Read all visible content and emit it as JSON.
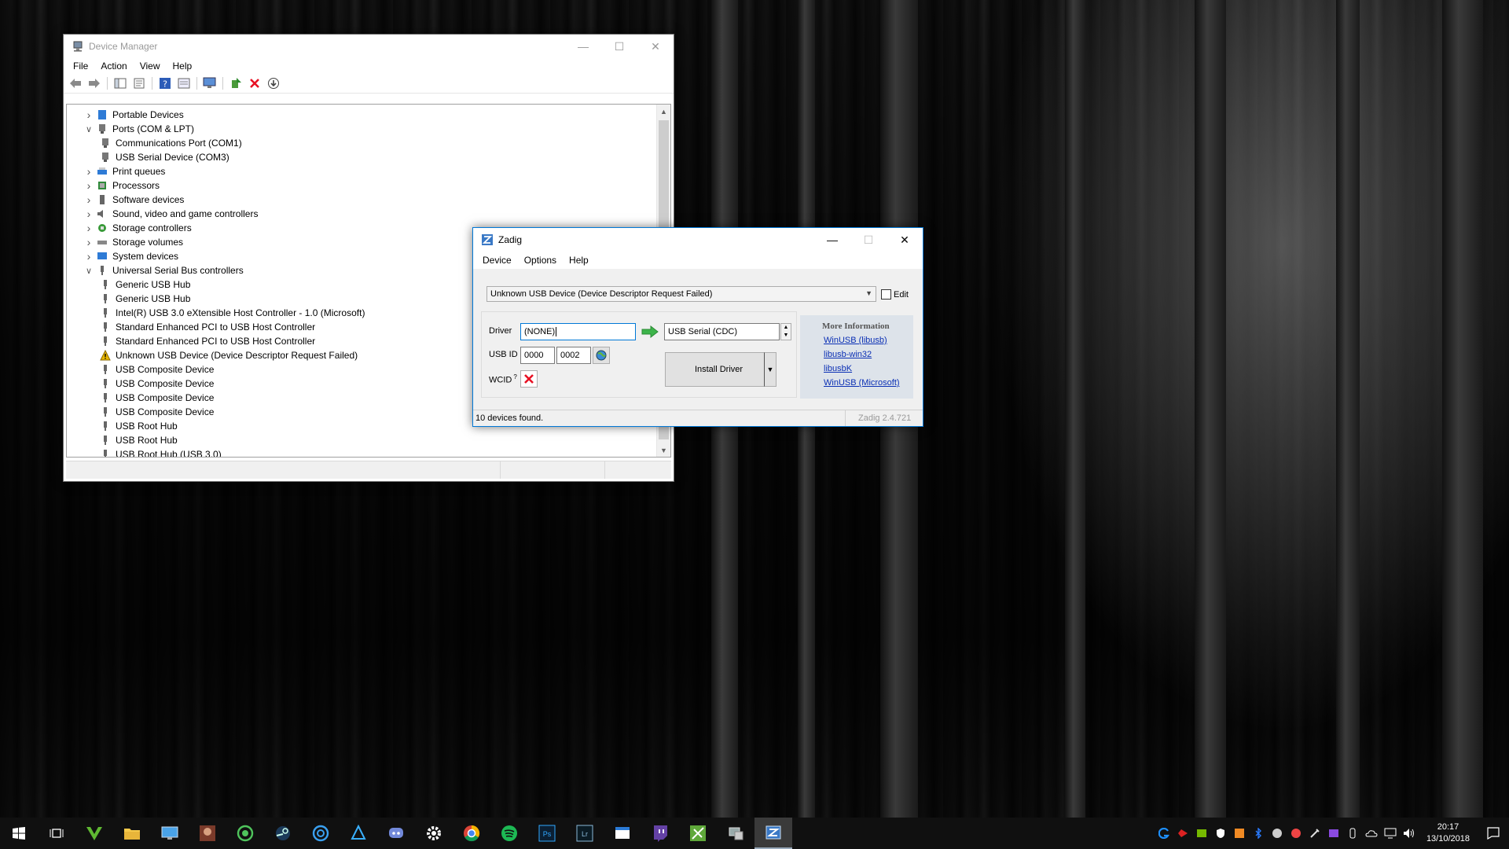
{
  "device_manager": {
    "title": "Device Manager",
    "menu": [
      "File",
      "Action",
      "View",
      "Help"
    ],
    "tree": [
      {
        "label": "Portable Devices",
        "level": 1,
        "expander": "collapsed",
        "icon": "portable-device-icon"
      },
      {
        "label": "Ports (COM & LPT)",
        "level": 1,
        "expander": "expanded",
        "icon": "port-icon"
      },
      {
        "label": "Communications Port (COM1)",
        "level": 2,
        "expander": "none",
        "icon": "port-icon"
      },
      {
        "label": "USB Serial Device (COM3)",
        "level": 2,
        "expander": "none",
        "icon": "port-icon"
      },
      {
        "label": "Print queues",
        "level": 1,
        "expander": "collapsed",
        "icon": "printer-icon"
      },
      {
        "label": "Processors",
        "level": 1,
        "expander": "collapsed",
        "icon": "processor-icon"
      },
      {
        "label": "Software devices",
        "level": 1,
        "expander": "collapsed",
        "icon": "software-device-icon"
      },
      {
        "label": "Sound, video and game controllers",
        "level": 1,
        "expander": "collapsed",
        "icon": "sound-icon"
      },
      {
        "label": "Storage controllers",
        "level": 1,
        "expander": "collapsed",
        "icon": "storage-controller-icon"
      },
      {
        "label": "Storage volumes",
        "level": 1,
        "expander": "collapsed",
        "icon": "storage-volume-icon"
      },
      {
        "label": "System devices",
        "level": 1,
        "expander": "collapsed",
        "icon": "system-device-icon"
      },
      {
        "label": "Universal Serial Bus controllers",
        "level": 1,
        "expander": "expanded",
        "icon": "usb-icon"
      },
      {
        "label": "Generic USB Hub",
        "level": 2,
        "expander": "none",
        "icon": "usb-icon"
      },
      {
        "label": "Generic USB Hub",
        "level": 2,
        "expander": "none",
        "icon": "usb-icon"
      },
      {
        "label": "Intel(R) USB 3.0 eXtensible Host Controller - 1.0 (Microsoft)",
        "level": 2,
        "expander": "none",
        "icon": "usb-icon"
      },
      {
        "label": "Standard Enhanced PCI to USB Host Controller",
        "level": 2,
        "expander": "none",
        "icon": "usb-icon"
      },
      {
        "label": "Standard Enhanced PCI to USB Host Controller",
        "level": 2,
        "expander": "none",
        "icon": "usb-icon"
      },
      {
        "label": "Unknown USB Device (Device Descriptor Request Failed)",
        "level": 2,
        "expander": "none",
        "icon": "warning-icon"
      },
      {
        "label": "USB Composite Device",
        "level": 2,
        "expander": "none",
        "icon": "usb-icon"
      },
      {
        "label": "USB Composite Device",
        "level": 2,
        "expander": "none",
        "icon": "usb-icon"
      },
      {
        "label": "USB Composite Device",
        "level": 2,
        "expander": "none",
        "icon": "usb-icon"
      },
      {
        "label": "USB Composite Device",
        "level": 2,
        "expander": "none",
        "icon": "usb-icon"
      },
      {
        "label": "USB Root Hub",
        "level": 2,
        "expander": "none",
        "icon": "usb-icon"
      },
      {
        "label": "USB Root Hub",
        "level": 2,
        "expander": "none",
        "icon": "usb-icon"
      },
      {
        "label": "USB Root Hub (USB 3.0)",
        "level": 2,
        "expander": "none",
        "icon": "usb-icon"
      }
    ]
  },
  "zadig": {
    "title": "Zadig",
    "menu": [
      "Device",
      "Options",
      "Help"
    ],
    "device_select": "Unknown USB Device (Device Descriptor Request Failed)",
    "edit_label": "Edit",
    "driver_label": "Driver",
    "driver_current": "(NONE)",
    "driver_target": "USB Serial (CDC)",
    "usb_id_label": "USB ID",
    "usb_vid": "0000",
    "usb_pid": "0002",
    "wcid_label": "WCID",
    "wcid_sup": "?",
    "install_button": "Install Driver",
    "more_info_title": "More Information",
    "links": [
      "WinUSB (libusb)",
      "libusb-win32",
      "libusbK",
      "WinUSB (Microsoft)"
    ],
    "status": "10 devices found.",
    "version": "Zadig 2.4.721"
  },
  "taskbar": {
    "time": "20:17",
    "date": "13/10/2018"
  },
  "colors": {
    "accent": "#0078d7",
    "link": "#0a2fb4",
    "warning": "#e8b700",
    "error_x": "#e81123",
    "arrow_green": "#3cb44a"
  }
}
